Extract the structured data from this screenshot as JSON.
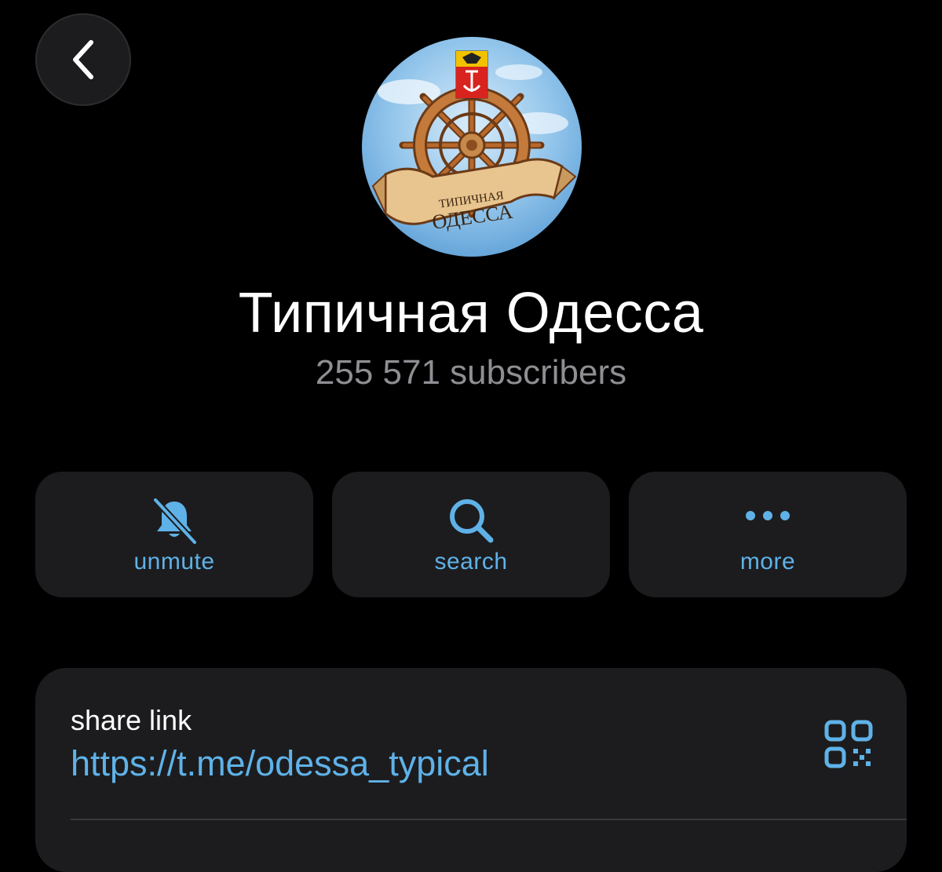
{
  "navigation": {
    "back_icon": "chevron-left-icon"
  },
  "channel": {
    "title": "Типичная Одесса",
    "subscribers": "255 571 subscribers",
    "avatar_text_line1": "ТИПИЧНАЯ",
    "avatar_text_line2": "ОДЕССА"
  },
  "actions": [
    {
      "label": "unmute",
      "icon": "bell-slash-icon"
    },
    {
      "label": "search",
      "icon": "magnifier-icon"
    },
    {
      "label": "more",
      "icon": "ellipsis-icon"
    }
  ],
  "info": {
    "share_label": "share link",
    "share_url": "https://t.me/odessa_typical",
    "qr_icon": "qr-code-icon"
  },
  "colors": {
    "background": "#000000",
    "card": "#1c1c1e",
    "accent": "#5fb2e8",
    "secondary_text": "#8e8e93"
  }
}
